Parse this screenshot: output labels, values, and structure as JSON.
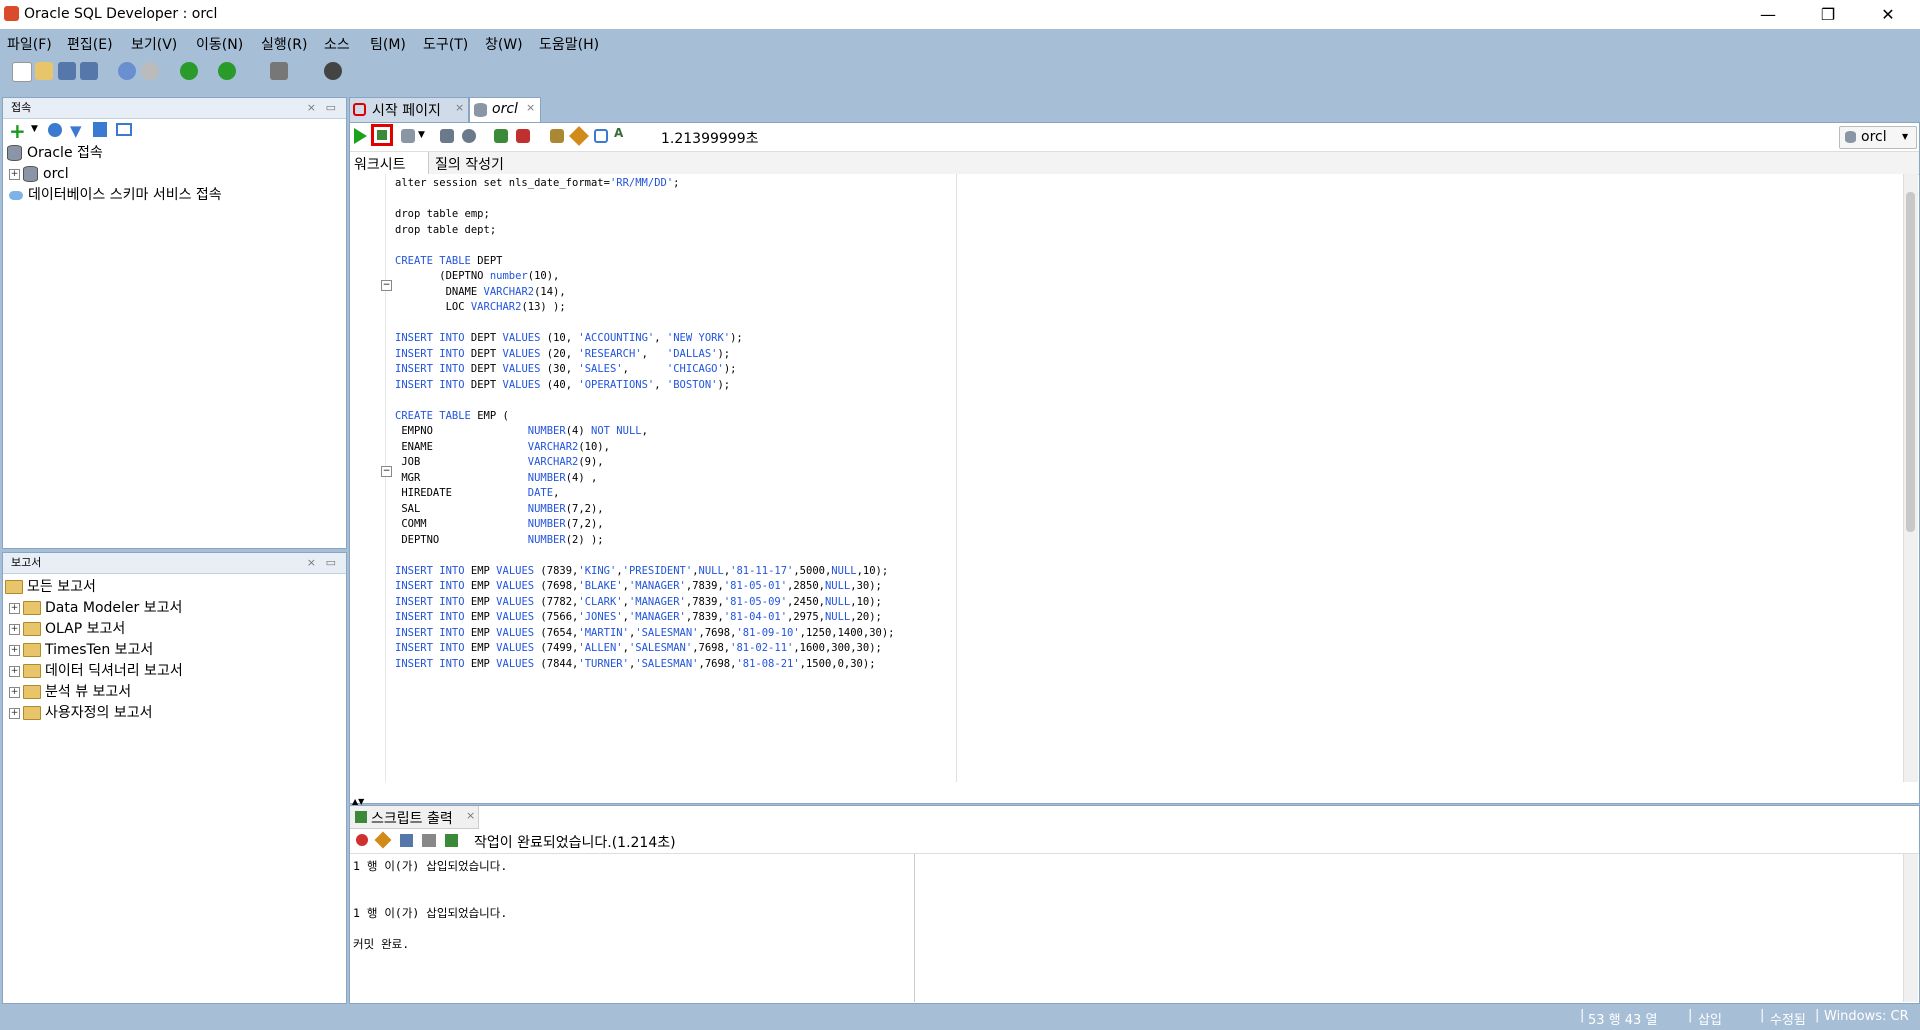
{
  "window": {
    "title": "Oracle SQL Developer : orcl",
    "minimize": "—",
    "maximize": "❐",
    "close": "✕"
  },
  "menu": [
    "파일(F)",
    "편집(E)",
    "보기(V)",
    "이동(N)",
    "실행(R)",
    "소스",
    "팀(M)",
    "도구(T)",
    "창(W)",
    "도움말(H)"
  ],
  "connections_panel": {
    "title": "접속",
    "items": [
      "Oracle 접속",
      "orcl",
      "데이터베이스 스키마 서비스 접속"
    ]
  },
  "reports_panel": {
    "title": "보고서",
    "items": [
      "모든 보고서",
      "Data Modeler 보고서",
      "OLAP 보고서",
      "TimesTen 보고서",
      "데이터 딕셔너리 보고서",
      "분석 뷰 보고서",
      "사용자정의 보고서"
    ]
  },
  "editor_tabs": [
    "시작 페이지",
    "orcl"
  ],
  "editor_toolbar": {
    "elapsed": "1.21399999초",
    "connection": "orcl"
  },
  "subtabs": [
    "워크시트",
    "질의 작성기"
  ],
  "code_lines": [
    "alter session set nls_date_format='RR/MM/DD';",
    "",
    "drop table emp;",
    "drop table dept;",
    "",
    "CREATE TABLE DEPT",
    "       (DEPTNO number(10),",
    "        DNAME VARCHAR2(14),",
    "        LOC VARCHAR2(13) );",
    "",
    "INSERT INTO DEPT VALUES (10, 'ACCOUNTING', 'NEW YORK');",
    "INSERT INTO DEPT VALUES (20, 'RESEARCH',   'DALLAS');",
    "INSERT INTO DEPT VALUES (30, 'SALES',      'CHICAGO');",
    "INSERT INTO DEPT VALUES (40, 'OPERATIONS', 'BOSTON');",
    "",
    "CREATE TABLE EMP (",
    " EMPNO               NUMBER(4) NOT NULL,",
    " ENAME               VARCHAR2(10),",
    " JOB                 VARCHAR2(9),",
    " MGR                 NUMBER(4) ,",
    " HIREDATE            DATE,",
    " SAL                 NUMBER(7,2),",
    " COMM                NUMBER(7,2),",
    " DEPTNO              NUMBER(2) );",
    "",
    "INSERT INTO EMP VALUES (7839,'KING','PRESIDENT',NULL,'81-11-17',5000,NULL,10);",
    "INSERT INTO EMP VALUES (7698,'BLAKE','MANAGER',7839,'81-05-01',2850,NULL,30);",
    "INSERT INTO EMP VALUES (7782,'CLARK','MANAGER',7839,'81-05-09',2450,NULL,10);",
    "INSERT INTO EMP VALUES (7566,'JONES','MANAGER',7839,'81-04-01',2975,NULL,20);",
    "INSERT INTO EMP VALUES (7654,'MARTIN','SALESMAN',7698,'81-09-10',1250,1400,30);",
    "INSERT INTO EMP VALUES (7499,'ALLEN','SALESMAN',7698,'81-02-11',1600,300,30);",
    "INSERT INTO EMP VALUES (7844,'TURNER','SALESMAN',7698,'81-08-21',1500,0,30);"
  ],
  "output_panel": {
    "tab": "스크립트 출력",
    "status": "작업이 완료되었습니다.(1.214초)",
    "lines": [
      "1 행 이(가) 삽입되었습니다.",
      "",
      "",
      "1 행 이(가) 삽입되었습니다.",
      "",
      "커밋 완료."
    ]
  },
  "statusbar": {
    "position": "53 행 43 열",
    "mode": "삽입",
    "modified": "수정됨",
    "eol": "Windows: CR"
  },
  "colors": {
    "accent": "#a6bed6",
    "keyword": "#2255dd",
    "highlight_box": "#e00000"
  }
}
